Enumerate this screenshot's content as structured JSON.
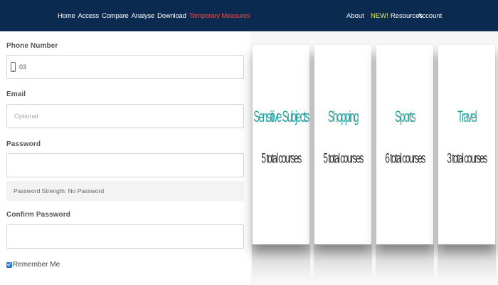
{
  "nav": {
    "left_links": [
      {
        "label": "Home",
        "alert": false
      },
      {
        "label": "Access",
        "alert": false
      },
      {
        "label": "Compare",
        "alert": false
      },
      {
        "label": "Analyse",
        "alert": false
      },
      {
        "label": "Download",
        "alert": false
      },
      {
        "label": "Temporary Measures",
        "alert": true
      }
    ],
    "about": "About",
    "new_badge": "NEW!",
    "resources": "Resources",
    "account": "Account"
  },
  "form": {
    "phone_label": "Phone Number",
    "phone_value": "03",
    "email_label": "Email",
    "email_placeholder": "Optional",
    "password_label": "Password",
    "password_strength": "Password Strength: No Password",
    "confirm_label": "Confirm Password",
    "remember_label": "Remember Me",
    "remember_checked": true
  },
  "cards": [
    {
      "title": "Sensitive Subjects",
      "count": "5 total courses"
    },
    {
      "title": "Shopping",
      "count": "5 total courses"
    },
    {
      "title": "Sports",
      "count": "6 total courses"
    },
    {
      "title": "Travel",
      "count": "3 total courses"
    }
  ],
  "colors": {
    "navbar": "#0b2a4f",
    "alert_link": "#ef4a4a",
    "new_badge": "#e8f04d",
    "card_title": "#2aa2a0",
    "checkbox": "#2e78d6"
  }
}
